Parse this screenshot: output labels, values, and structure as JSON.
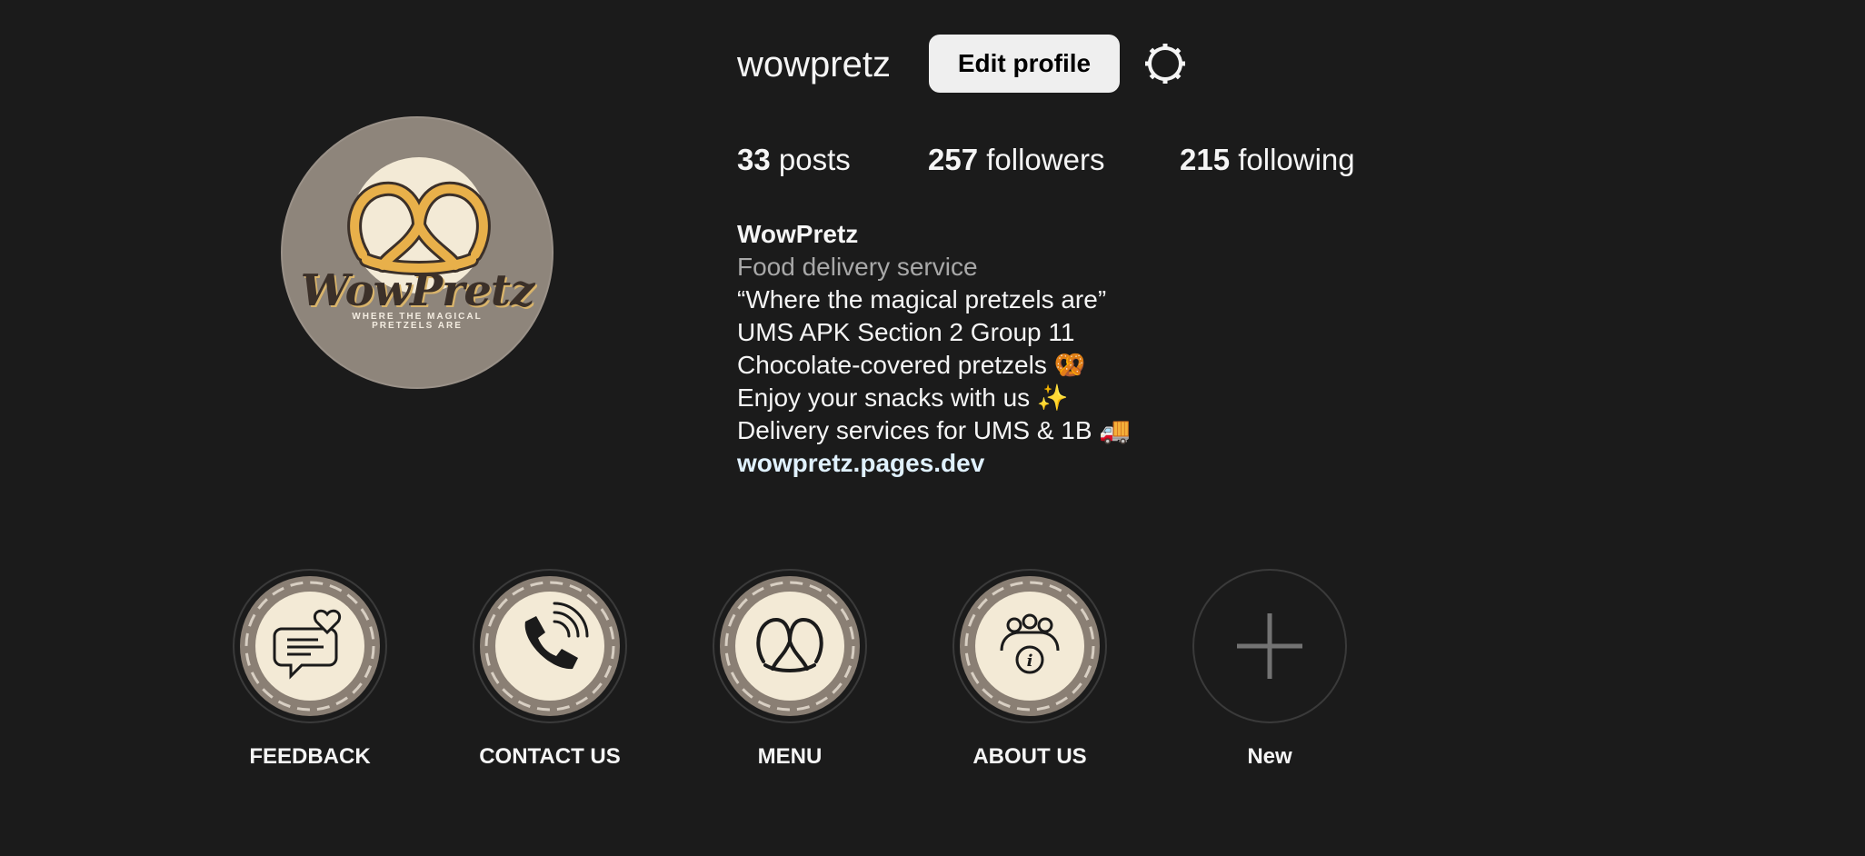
{
  "profile": {
    "username": "wowpretz",
    "edit_label": "Edit profile",
    "logo_word": "WowPretz",
    "logo_tagline_1": "WHERE THE MAGICAL",
    "logo_tagline_2": "PRETZELS ARE"
  },
  "stats": {
    "posts_count": "33",
    "posts_label": "posts",
    "followers_count": "257",
    "followers_label": "followers",
    "following_count": "215",
    "following_label": "following"
  },
  "bio": {
    "name": "WowPretz",
    "category": "Food delivery service",
    "lines": [
      "“Where the magical pretzels are”",
      "UMS APK Section 2 Group 11",
      "Chocolate-covered pretzels 🥨",
      "Enjoy your snacks with us ✨",
      "Delivery services for UMS & 1B 🚚"
    ],
    "link": "wowpretz.pages.dev"
  },
  "highlights": [
    {
      "label": "FEEDBACK",
      "icon": "feedback-chat-heart-icon"
    },
    {
      "label": "CONTACT US",
      "icon": "phone-icon"
    },
    {
      "label": "MENU",
      "icon": "pretzel-icon"
    },
    {
      "label": "ABOUT US",
      "icon": "people-info-icon"
    },
    {
      "label": "New",
      "icon": "plus-icon"
    }
  ],
  "colors": {
    "background": "#1b1b1b",
    "button_bg": "#efefef",
    "category_text": "#a8a8a8",
    "link_text": "#e0f1ff",
    "avatar_bg": "#8e857b",
    "highlight_fill": "#f3ead6"
  }
}
